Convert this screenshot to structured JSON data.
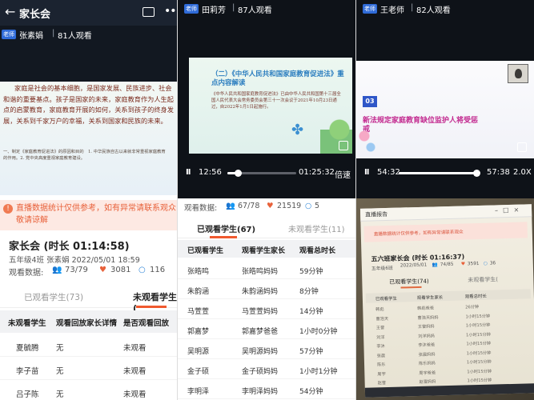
{
  "panelA": {
    "back_icon": "←",
    "title": "家长会",
    "host_tag": "老师",
    "host_name": "张素娟",
    "separator": "|",
    "viewers": "81人观看",
    "slide_text": "家庭是社会的基本细胞，是国家发展、民族进步、社会和谐的重要基点。孩子是国家的未来，家庭教育作为人生起点的启蒙教育，家庭教育开展的如何，关系到孩子的终身发展，关系到千家万户的幸福，关系到国家和民族的未来。",
    "slide_sub": "一、制定《家庭教育促进法》的原因和目的　1. 中华民族自古以来就非常重视家庭教育的作用。2. 党中央高度重视家庭教育建设。",
    "notice": "直播数据统计仅供参考，如有异常请联系观众敬请谅解",
    "meeting_title": "家长会 (时长 01:14:58)",
    "meeting_info": "五年级4班 张素娟 2022/05/01 18:59",
    "stats_label": "观看数据:",
    "stats_viewers": "73/79",
    "stats_likes": "3081",
    "stats_comments": "116",
    "tab_watched": "已观看学生(73)",
    "tab_unwatched": "未观看学生(",
    "columns": [
      "未观看学生",
      "观看回放家长详情",
      "是否观看回放"
    ],
    "rows": [
      [
        "夏毓腾",
        "无",
        "未观看"
      ],
      [
        "李子苗",
        "无",
        "未观看"
      ],
      [
        "吕子陈",
        "无",
        "未观看"
      ]
    ]
  },
  "panelB": {
    "host_tag": "老师",
    "host_name": "田莉芳",
    "separator": "|",
    "viewers": "87人观看",
    "slide_title": "（二）《中华人民共和国家庭教育促进法》重点内容解读",
    "slide_body": "《中华人民共和国家庭教育促进法》已由中华人民共和国第十三届全国人民代表大会常务委员会第三十一次会议于2021年10月23日通过，自2022年1月1日起施行。",
    "pause_icon": "II",
    "time_current": "12:56",
    "time_total": "01:25:32",
    "speed": "倍速",
    "progress": 0.15
  },
  "panelC": {
    "stats_label": "观看数据:",
    "stats_viewers": "67/78",
    "stats_likes": "21519",
    "stats_comments": "5",
    "tab_watched": "已观看学生(67)",
    "tab_unwatched": "未观看学生(11)",
    "columns": [
      "已观看学生",
      "观看学生家长",
      "观看总时长"
    ],
    "rows": [
      [
        "张皓鸣",
        "张皓鸣妈妈",
        "59分钟"
      ],
      [
        "朱韵涵",
        "朱韵涵妈妈",
        "8分钟"
      ],
      [
        "马萱萱",
        "马萱萱妈妈",
        "14分钟"
      ],
      [
        "郭嘉梦",
        "郭嘉梦爸爸",
        "1小时0分钟"
      ],
      [
        "吴明源",
        "吴明源妈妈",
        "57分钟"
      ],
      [
        "金子硕",
        "金子硕妈妈",
        "1小时1分钟"
      ],
      [
        "李明泽",
        "李明泽妈妈",
        "54分钟"
      ]
    ]
  },
  "panelD": {
    "host_tag": "老师",
    "host_name": "王老师",
    "separator": "|",
    "viewers": "82人观看",
    "slide_num": "03",
    "slide_title": "新法规定家庭教育缺位监护人将受惩戒",
    "pause_icon": "II",
    "time_current": "54:32",
    "time_total": "57:38",
    "speed": "2.0X",
    "progress": 0.95
  },
  "panelE": {
    "window_title": "直播报告",
    "window_controls": "–□×",
    "warning": "直播数据统计仅供参考，如有异常请联系观众",
    "meeting_title": "五六班家长会 (时长 01:16:37)",
    "info_grade": "五年级6班",
    "info_date": "2022/05/01",
    "stats_viewers": "74/85",
    "stats_likes": "3591",
    "stats_comments": "36",
    "tab_watched": "已观看学生(74)",
    "tab_unwatched": "未观看学生(",
    "columns": [
      "已观看学生",
      "观看学生家长",
      "观看总时长"
    ],
    "rows": [
      [
        "韩彪",
        "韩彪爸爸",
        "26分钟"
      ],
      [
        "曹浩天",
        "曹浩天妈妈",
        "1小时15分钟"
      ],
      [
        "王誉",
        "王誉妈妈",
        "1小时15分钟"
      ],
      [
        "刘洋",
        "刘洋妈妈",
        "1小时15分钟"
      ],
      [
        "李沐",
        "李沐爸爸",
        "1小时15分钟"
      ],
      [
        "张晨",
        "张晨妈妈",
        "1小时15分钟"
      ],
      [
        "陈乐",
        "陈乐妈妈",
        "1小时15分钟"
      ],
      [
        "周宇",
        "周宇爸爸",
        "1小时15分钟"
      ],
      [
        "赵雪",
        "赵雪妈妈",
        "1小时15分钟"
      ]
    ]
  },
  "icons": {
    "viewers": "👥",
    "likes": "♥",
    "comments": "○",
    "more": "•••"
  }
}
